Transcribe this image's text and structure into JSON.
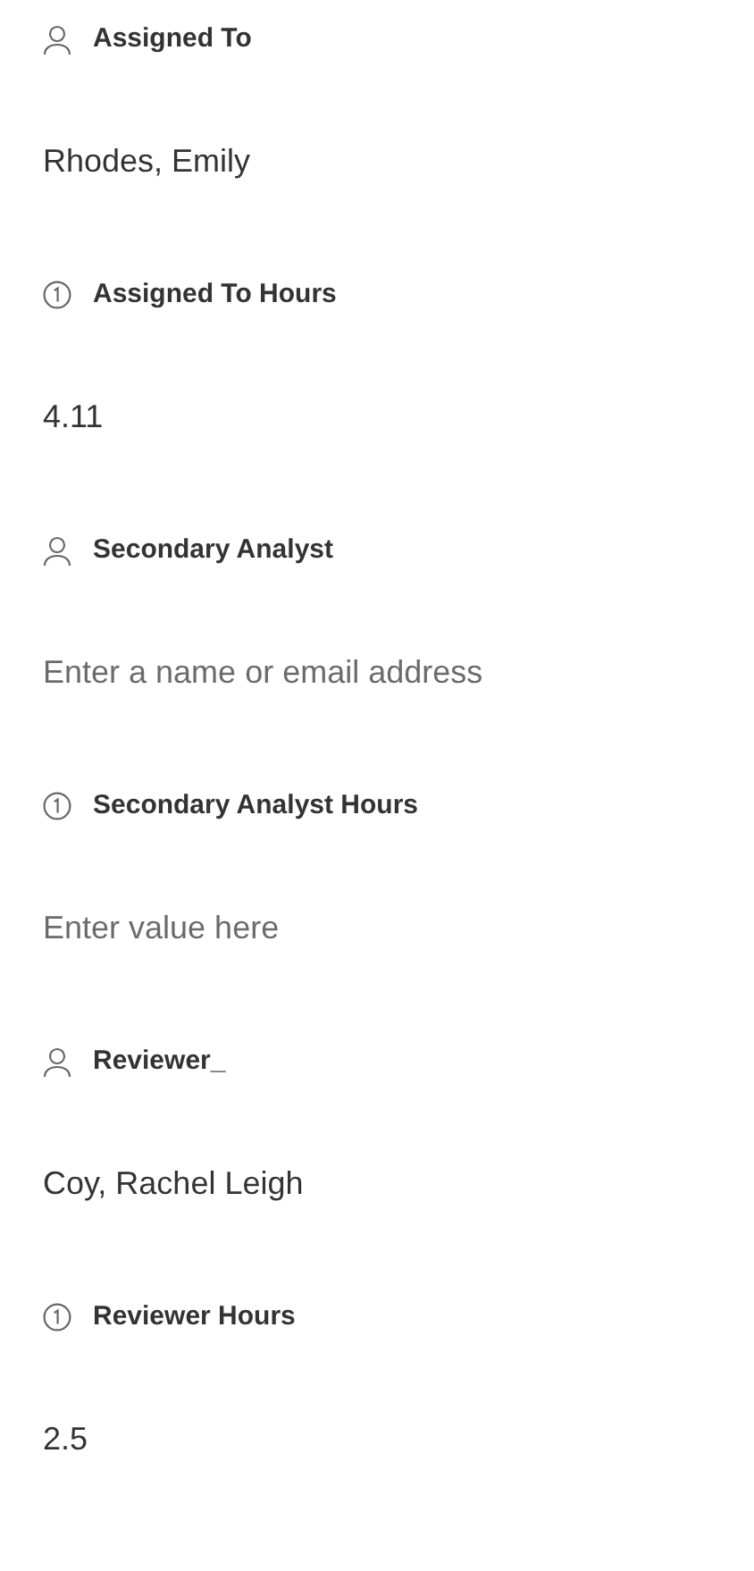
{
  "fields": [
    {
      "kind": "person",
      "label": "Assigned To",
      "value": "Rhodes, Emily"
    },
    {
      "kind": "number",
      "label": "Assigned To Hours",
      "value": "4.11"
    },
    {
      "kind": "person",
      "label": "Secondary Analyst",
      "placeholder": "Enter a name or email address"
    },
    {
      "kind": "number",
      "label": "Secondary Analyst Hours",
      "placeholder": "Enter value here"
    },
    {
      "kind": "person",
      "label": "Reviewer_",
      "value": "Coy, Rachel Leigh"
    },
    {
      "kind": "number",
      "label": "Reviewer Hours",
      "value": "2.5"
    }
  ]
}
